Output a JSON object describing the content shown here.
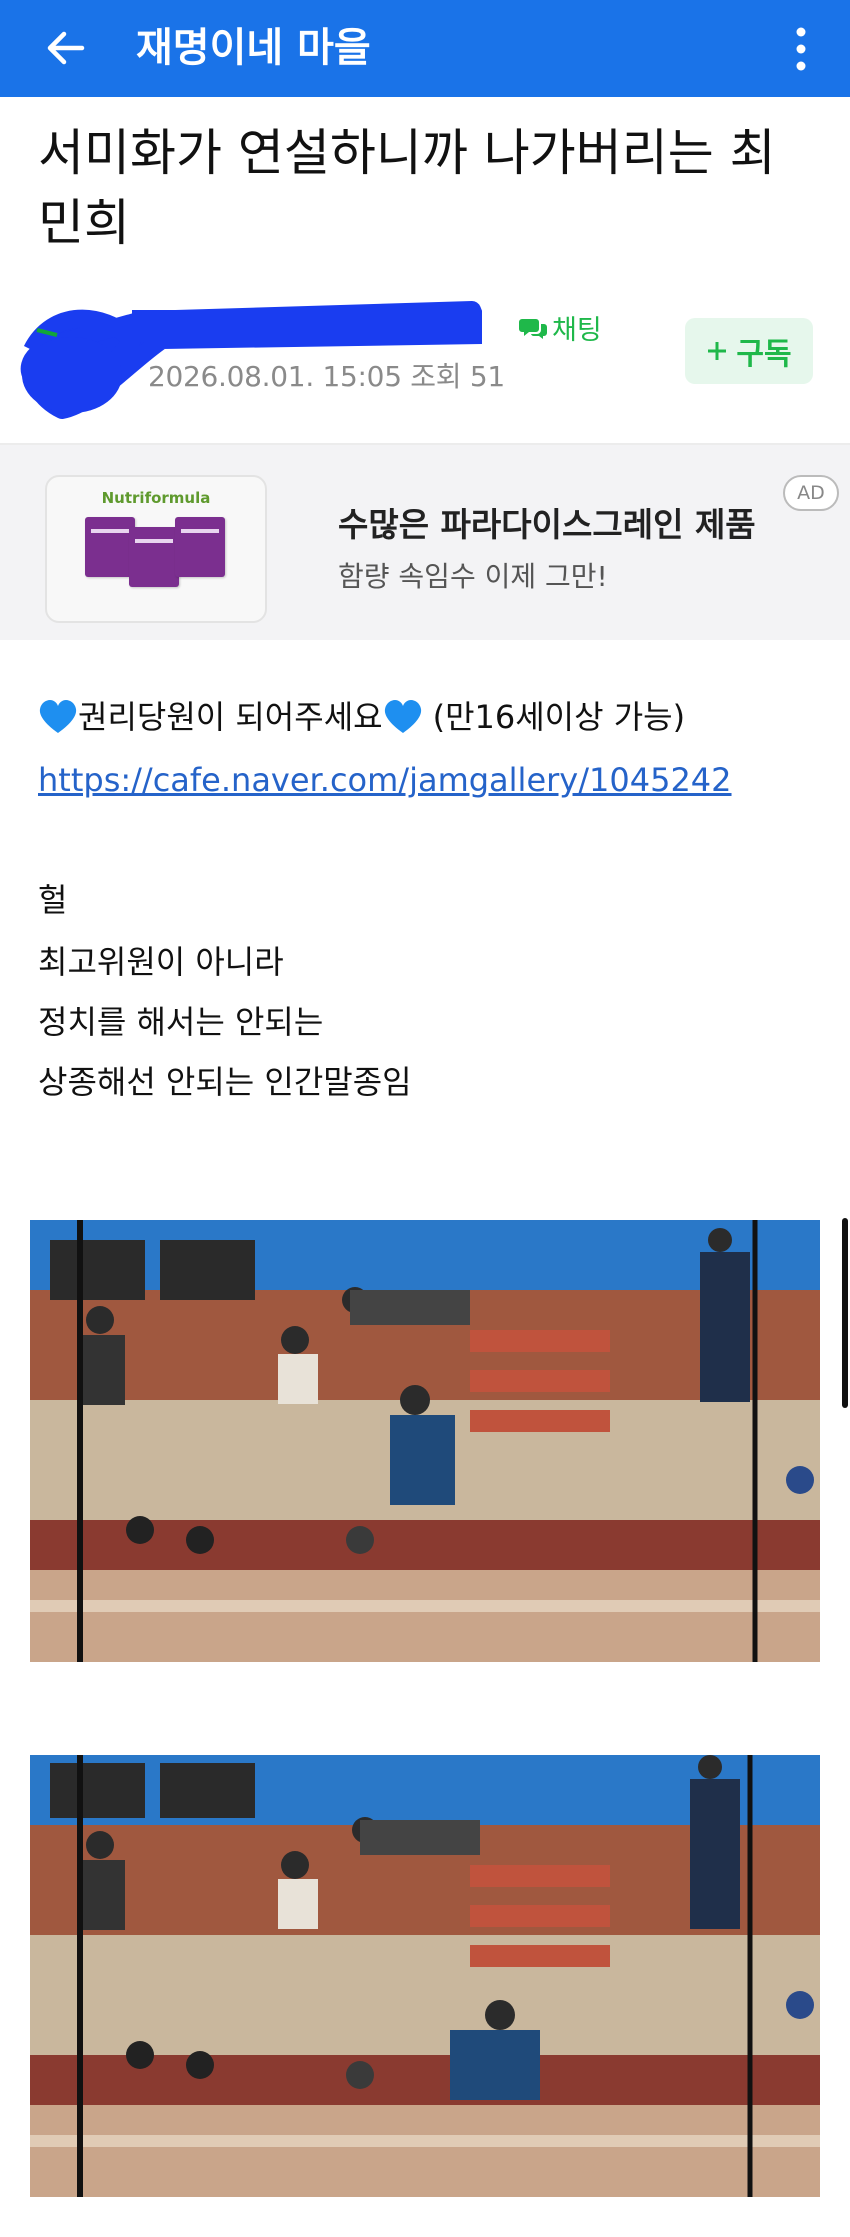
{
  "appbar": {
    "title": "재명이네 마을",
    "back_icon": "arrow-left-icon",
    "more_icon": "more-vertical-icon",
    "color": "#1a73e8"
  },
  "post": {
    "title": "서미화가 연설하니까 나가버리는 최민희",
    "meta": "2026.08.01. 15:05  조회 51",
    "chat_label": "채팅",
    "subscribe_label": "구독"
  },
  "ad": {
    "brand": "Nutriformula",
    "headline": "수많은 파라다이스그레인 제품",
    "subline": "함량 속임수 이제 그만!",
    "badge": "AD"
  },
  "body": {
    "line1": "권리당원이 되어주세요",
    "line1_suffix": "(만16세이상 가능)",
    "link": "https://cafe.naver.com/jamgallery/1045242",
    "lines": [
      "헐",
      "최고위원이 아니라",
      "정치를 해서는 안되는",
      "상종해선 안되는 인간말종임"
    ]
  },
  "colors": {
    "accent_green": "#1fb84a",
    "link_blue": "#2563c9",
    "ad_background": "#f3f3f5"
  }
}
